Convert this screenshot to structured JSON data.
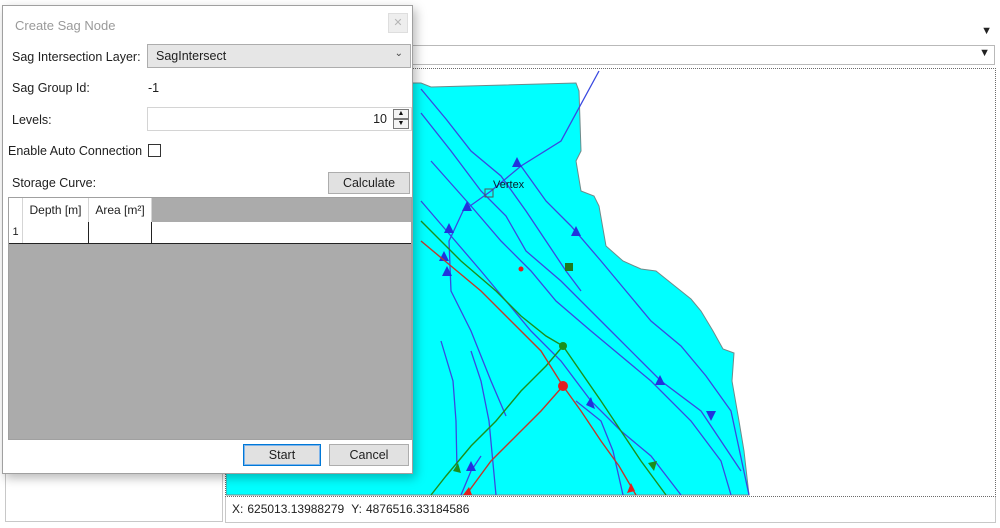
{
  "dialog": {
    "title": "Create Sag Node",
    "close_glyph": "✕",
    "intersection_layer_label": "Sag Intersection Layer:",
    "intersection_layer_value": "SagIntersect",
    "group_id_label": "Sag Group Id:",
    "group_id_value": "-1",
    "levels_label": "Levels:",
    "levels_value": "10",
    "auto_connection_label": "Enable Auto Connection",
    "auto_connection_checked": false,
    "storage_curve_label": "Storage Curve:",
    "calculate_button": "Calculate",
    "grid": {
      "columns": [
        "Depth [m]",
        "Area [m²]"
      ],
      "rows": [
        {
          "index": "1",
          "depth": "",
          "area": ""
        }
      ]
    },
    "start_button": "Start",
    "cancel_button": "Cancel"
  },
  "map": {
    "vertex_label": "Vertex",
    "colors": {
      "water": "#00ffff",
      "flow_line": "#3a49e0",
      "green_line": "#1c8f1c",
      "red_line": "#c0392b",
      "vertex_marker": "#1f7a1f"
    }
  },
  "status_bar": {
    "x_label": "X:",
    "x_value": "625013.13988279",
    "y_label": "Y:",
    "y_value": "4876516.33184586"
  },
  "icons": [
    "chevron-down-icon",
    "close-icon",
    "spin-up-icon",
    "spin-down-icon",
    "dropdown-arrow-icon"
  ]
}
